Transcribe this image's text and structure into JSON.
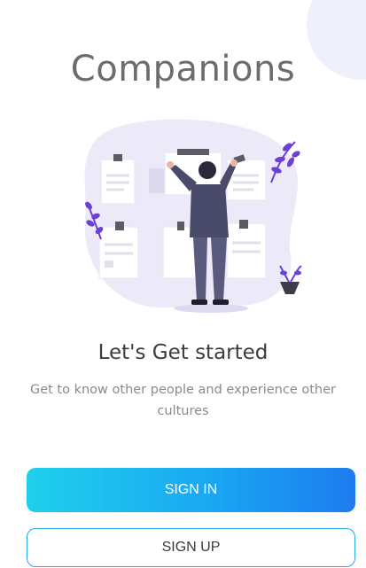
{
  "app": {
    "title": "Companions"
  },
  "onboarding": {
    "headline": "Let's Get started",
    "subtitle": "Get to know other people and experience other cultures",
    "illustration_icon": "person-arranging-notes-illustration"
  },
  "actions": {
    "sign_in_label": "SIGN IN",
    "sign_up_label": "SIGN UP"
  },
  "colors": {
    "primary_gradient_start": "#1fd0ec",
    "primary_gradient_end": "#1e7bf0",
    "outline_border": "#2aa7e8",
    "title_text": "#6b6b70",
    "illustration_blob": "#eceaf8",
    "accent_purple": "#6c3fd6"
  }
}
